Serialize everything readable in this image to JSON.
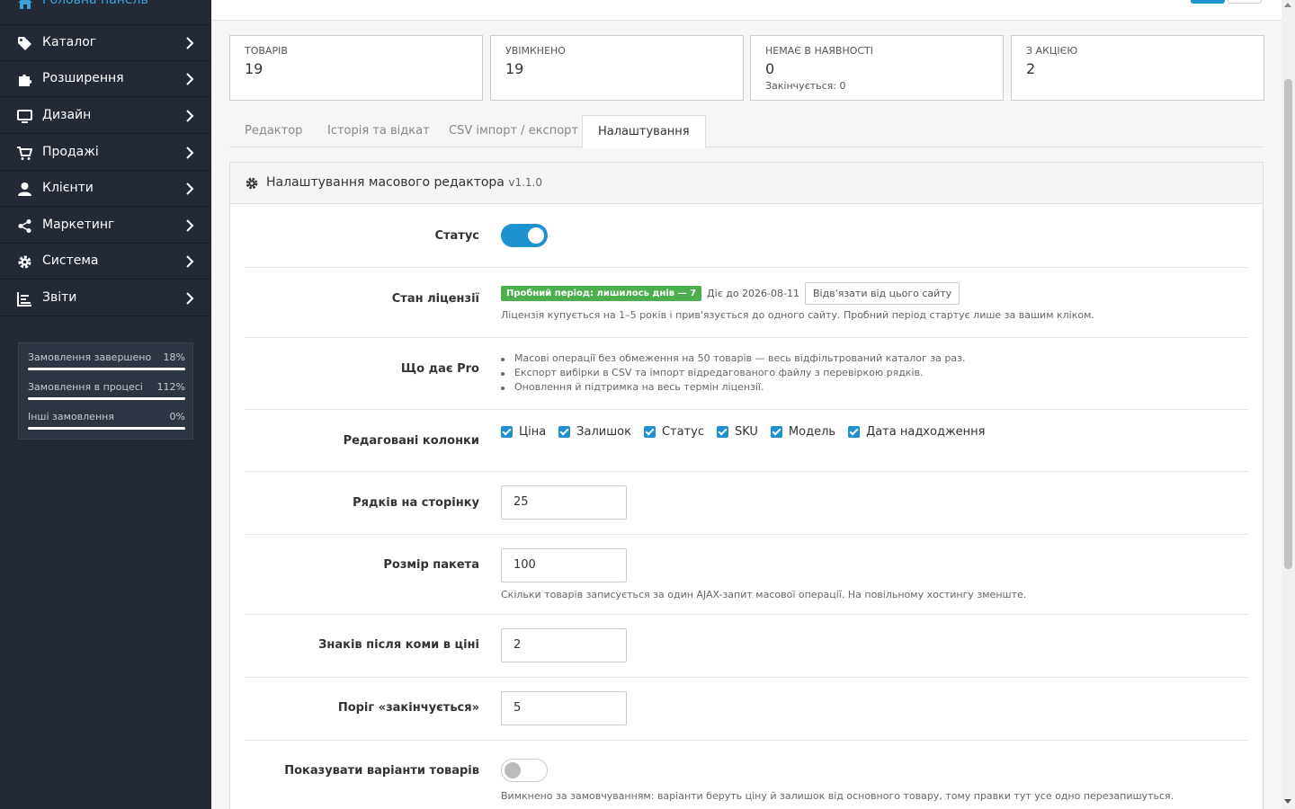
{
  "sidebar": {
    "home": "Головна панель",
    "items": [
      {
        "label": "Каталог",
        "icon": "tag-icon"
      },
      {
        "label": "Розширення",
        "icon": "puzzle-icon"
      },
      {
        "label": "Дизайн",
        "icon": "monitor-icon"
      },
      {
        "label": "Продажі",
        "icon": "cart-icon"
      },
      {
        "label": "Клієнти",
        "icon": "user-icon"
      },
      {
        "label": "Маркетинг",
        "icon": "share-icon"
      },
      {
        "label": "Система",
        "icon": "gear-icon"
      },
      {
        "label": "Звіти",
        "icon": "bar-chart-icon"
      }
    ],
    "stats": [
      {
        "label": "Замовлення завершено",
        "pct": "18%"
      },
      {
        "label": "Замовлення в процесі",
        "pct": "112%"
      },
      {
        "label": "Інші замовлення",
        "pct": "0%"
      }
    ]
  },
  "cards": [
    {
      "label": "ТОВАРІВ",
      "value": "19",
      "sub": ""
    },
    {
      "label": "УВІМКНЕНО",
      "value": "19",
      "sub": ""
    },
    {
      "label": "НЕМАЄ В НАЯВНОСТІ",
      "value": "0",
      "sub": "Закінчується: 0"
    },
    {
      "label": "З АКЦІЄЮ",
      "value": "2",
      "sub": ""
    }
  ],
  "tabs": [
    "Редактор",
    "Історія та відкат",
    "CSV імпорт / експорт",
    "Налаштування"
  ],
  "panel": {
    "title": "Налаштування масового редактора",
    "version": "v1.1.0"
  },
  "form": {
    "status_label": "Статус",
    "license_label": "Стан ліцензії",
    "license_badge": "Пробний період: лишилось днів — 7",
    "license_until": "Діє до 2026-08-11",
    "unbind_button": "Відв'язати від цього сайту",
    "license_help": "Ліцензія купується на 1–5 років і прив'язується до одного сайту. Пробний період стартує лише за вашим кліком.",
    "pro_label": "Що дає Pro",
    "pro_items": [
      "Масові операції без обмеження на 50 товарів — весь відфільтрований каталог за раз.",
      "Експорт вибірки в CSV та імпорт відредагованого файлу з перевіркою рядків.",
      "Оновлення й підтримка на весь термін ліцензії."
    ],
    "columns_label": "Редаговані колонки",
    "columns": [
      "Ціна",
      "Залишок",
      "Статус",
      "SKU",
      "Модель",
      "Дата надходження"
    ],
    "rows_label": "Рядків на сторінку",
    "rows_value": "25",
    "batch_label": "Розмір пакета",
    "batch_value": "100",
    "batch_help": "Скільки товарів записується за один AJAX-запит масової операції. На повільному хостингу зменште.",
    "decimals_label": "Знаків після коми в ціні",
    "decimals_value": "2",
    "threshold_label": "Поріг «закінчується»",
    "threshold_value": "5",
    "variants_label": "Показувати варіанти товарів",
    "variants_help": "Вимкнено за замовчуванням: варіанти беруть ціну й залишок від основного товару, тому правки тут усе одно перезапишуться."
  },
  "colors": {
    "sidebar_bg": "#232a36",
    "accent": "#1e91cf",
    "success": "#4cae4c"
  }
}
